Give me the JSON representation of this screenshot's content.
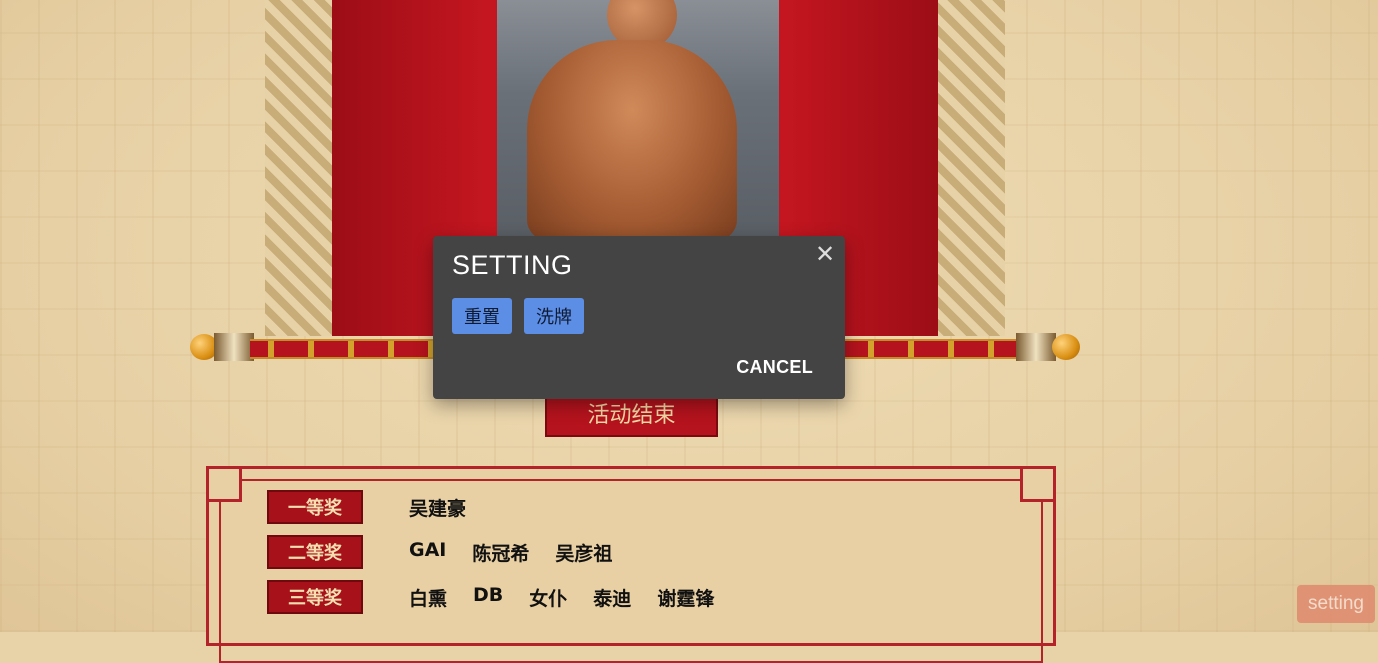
{
  "dialog": {
    "title": "SETTING",
    "close_symbol": "✕",
    "buttons": {
      "reset": "重置",
      "shuffle": "洗牌"
    },
    "cancel": "CANCEL"
  },
  "banner": {
    "ended": "活动结束"
  },
  "prizes": [
    {
      "label": "一等奖",
      "winners": [
        "吴建豪"
      ]
    },
    {
      "label": "二等奖",
      "winners": [
        "GAI",
        "陈冠希",
        "吴彦祖"
      ]
    },
    {
      "label": "三等奖",
      "winners": [
        "白熏",
        "DB",
        "女仆",
        "泰迪",
        "谢霆锋"
      ]
    }
  ],
  "fab": {
    "label": "setting"
  },
  "colors": {
    "dialog_bg": "#444444",
    "button_blue": "#5d8ee6",
    "prize_red": "#a7111a"
  }
}
